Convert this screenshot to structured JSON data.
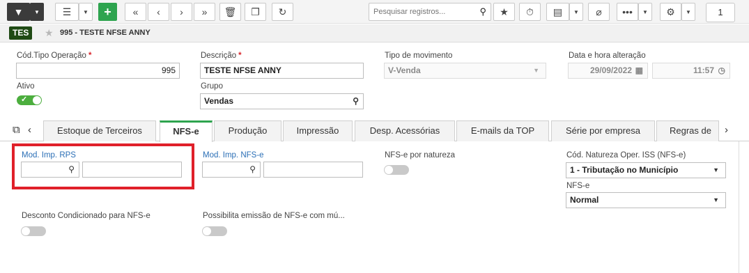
{
  "toolbar": {
    "search_placeholder": "Pesquisar registros...",
    "page_number": "1",
    "icons": [
      "filter-icon",
      "list-icon",
      "add-icon",
      "first-page-icon",
      "previous-page-icon",
      "next-page-icon",
      "last-page-icon",
      "delete-icon",
      "duplicate-icon",
      "refresh-icon",
      "search-icon",
      "star-icon",
      "timer-icon",
      "report-icon",
      "attach-icon",
      "more-icon",
      "settings-icon"
    ]
  },
  "record": {
    "badge": "TES",
    "title": "995 - TESTE NFSE ANNY"
  },
  "form": {
    "cod_tipo_operacao_label": "Cód.Tipo Operação",
    "cod_tipo_operacao_value": "995",
    "descricao_label": "Descrição",
    "descricao_value": "TESTE NFSE ANNY",
    "tipo_movimento_label": "Tipo de movimento",
    "tipo_movimento_value": "V-Venda",
    "data_hora_label": "Data e hora alteração",
    "data_value": "29/09/2022",
    "hora_value": "11:57",
    "ativo_label": "Ativo",
    "ativo_on": true,
    "grupo_label": "Grupo",
    "grupo_value": "Vendas"
  },
  "tabs": [
    {
      "label": "Estoque de Terceiros",
      "active": false
    },
    {
      "label": "NFS-e",
      "active": true
    },
    {
      "label": "Produção",
      "active": false
    },
    {
      "label": "Impressão",
      "active": false
    },
    {
      "label": "Desp. Acessórias",
      "active": false
    },
    {
      "label": "E-mails da TOP",
      "active": false
    },
    {
      "label": "Série por empresa",
      "active": false
    },
    {
      "label": "Regras de",
      "active": false
    }
  ],
  "nfse": {
    "mod_imp_rps_label": "Mod. Imp. RPS",
    "mod_imp_nfse_label": "Mod. Imp. NFS-e",
    "nfse_por_natureza_label": "NFS-e por natureza",
    "cod_natureza_label": "Cód. Natureza Oper. ISS (NFS-e)",
    "cod_natureza_value": "1 - Tributação no Município",
    "nfse_label": "NFS-e",
    "nfse_value": "Normal",
    "desconto_label": "Desconto Condicionado para NFS-e",
    "possibilita_label": "Possibilita emissão de NFS-e com mú..."
  },
  "colors": {
    "accent_green": "#2ea44f",
    "badge_green": "#1f4a14",
    "required_red": "#d9252b",
    "link_blue": "#2b6fb6",
    "highlight_red": "#e0202a"
  }
}
